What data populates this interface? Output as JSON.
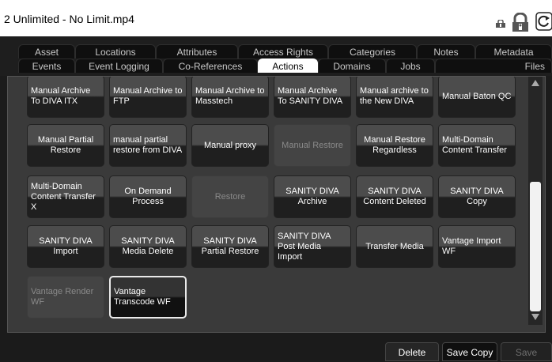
{
  "window": {
    "title": "2 Unlimited - No Limit.mp4"
  },
  "tabs_row1": [
    {
      "label": "Asset"
    },
    {
      "label": "Locations"
    },
    {
      "label": "Attributes"
    },
    {
      "label": "Access Rights"
    },
    {
      "label": "Categories"
    },
    {
      "label": "Notes"
    },
    {
      "label": "Metadata"
    }
  ],
  "tabs_row2": [
    {
      "label": "Events"
    },
    {
      "label": "Event Logging"
    },
    {
      "label": "Co-References"
    },
    {
      "label": "Actions",
      "active": true
    },
    {
      "label": "Domains"
    },
    {
      "label": "Jobs"
    },
    {
      "label": "Files"
    }
  ],
  "actions": [
    {
      "label": "Manual Archive To DIVA ITX"
    },
    {
      "label": "Manual Archive to FTP"
    },
    {
      "label": "Manual Archive to Masstech"
    },
    {
      "label": "Manual Archive To SANITY DIVA"
    },
    {
      "label": "Manual archive to the New DIVA"
    },
    {
      "label": "Manual Baton QC"
    },
    {
      "label": "Manual Partial Restore"
    },
    {
      "label": "manual partial restore from DIVA"
    },
    {
      "label": "Manual proxy"
    },
    {
      "label": "Manual Restore",
      "state": "disabled"
    },
    {
      "label": "Manual Restore Regardless"
    },
    {
      "label": "Multi-Domain Content Transfer"
    },
    {
      "label": "Multi-Domain Content Transfer X"
    },
    {
      "label": "On Demand Process"
    },
    {
      "label": "Restore",
      "state": "disabled"
    },
    {
      "label": "SANITY DIVA Archive"
    },
    {
      "label": "SANITY DIVA Content Deleted"
    },
    {
      "label": "SANITY DIVA Copy"
    },
    {
      "label": "SANITY DIVA Import"
    },
    {
      "label": "SANITY DIVA Media Delete"
    },
    {
      "label": "SANITY DIVA Partial Restore"
    },
    {
      "label": "SANITY DIVA Post Media Import"
    },
    {
      "label": "Transfer Media"
    },
    {
      "label": "Vantage Import WF"
    },
    {
      "label": "Vantage Render WF",
      "state": "disabled"
    },
    {
      "label": "Vantage Transcode WF",
      "state": "selected"
    }
  ],
  "footer": {
    "delete_label": "Delete",
    "save_copy_label": "Save Copy",
    "save_label": "Save"
  },
  "icons": {
    "lock_small": "padlock-info-icon",
    "lock_large": "padlock-info-icon",
    "refresh": "refresh-icon"
  },
  "colors": {
    "titlebar": "#ffffff",
    "background": "#1b1b1b",
    "panel": "#3a3a3a",
    "tile_top": "#4c4c4c",
    "tile_bottom": "#1f1f1f"
  }
}
